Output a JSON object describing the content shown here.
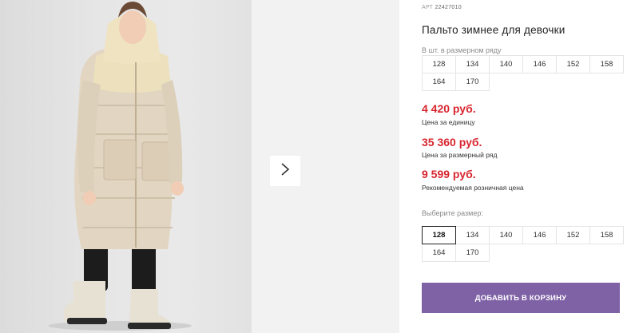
{
  "product": {
    "sku_prefix": "АРТ",
    "sku": "22427010",
    "title": "Пальто зимнее для девочки"
  },
  "row_sizes": {
    "label": "В шт. в размерном ряду",
    "items": [
      "128",
      "134",
      "140",
      "146",
      "152",
      "158",
      "164",
      "170"
    ]
  },
  "prices": {
    "unit_price": "4 420 руб.",
    "unit_note": "Цена за единицу",
    "row_price": "35 360 руб.",
    "row_note": "Цена за размерный ряд",
    "retail_price": "9 599 руб.",
    "retail_note": "Рекомендуемая розничная цена"
  },
  "size_picker": {
    "label": "Выберите размер:",
    "items": [
      "128",
      "134",
      "140",
      "146",
      "152",
      "158",
      "164",
      "170"
    ],
    "selected": "128"
  },
  "cart_button": {
    "label": "ДОБАВИТЬ В КОРЗИНУ"
  },
  "icons": {
    "next": "chevron-right-icon"
  },
  "colors": {
    "accent": "#7f62a6",
    "price": "#d8262f"
  }
}
